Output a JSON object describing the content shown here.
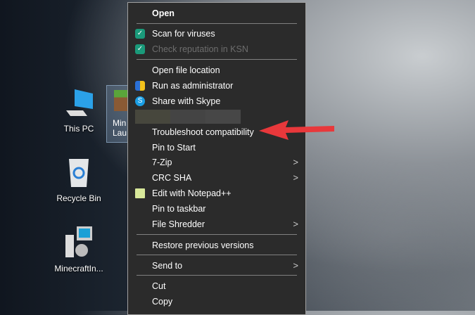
{
  "desktop": {
    "icons": [
      {
        "label": "This PC",
        "icon": "monitor-icon"
      },
      {
        "label": "Recycle Bin",
        "icon": "recycle-bin-icon"
      },
      {
        "label": "MinecraftIn...",
        "icon": "installer-icon"
      },
      {
        "label": "Min Lau",
        "icon": "minecraft-launcher-icon"
      }
    ]
  },
  "menu": {
    "items": {
      "open": "Open",
      "scan": "Scan for viruses",
      "check": "Check reputation in KSN",
      "open_location": "Open file location",
      "run_admin": "Run as administrator",
      "skype": "Share with Skype",
      "troubleshoot": "Troubleshoot compatibility",
      "pin_start": "Pin to Start",
      "zip": "7-Zip",
      "crc": "CRC SHA",
      "notepad": "Edit with Notepad++",
      "pin_taskbar": "Pin to taskbar",
      "shredder": "File Shredder",
      "restore": "Restore previous versions",
      "send_to": "Send to",
      "cut": "Cut",
      "copy": "Copy"
    }
  },
  "colors": {
    "arrow": "#e8383b",
    "menu_bg": "#2b2b2b",
    "kaspersky": "#1a9a7a",
    "skype": "#1a9ee4"
  }
}
